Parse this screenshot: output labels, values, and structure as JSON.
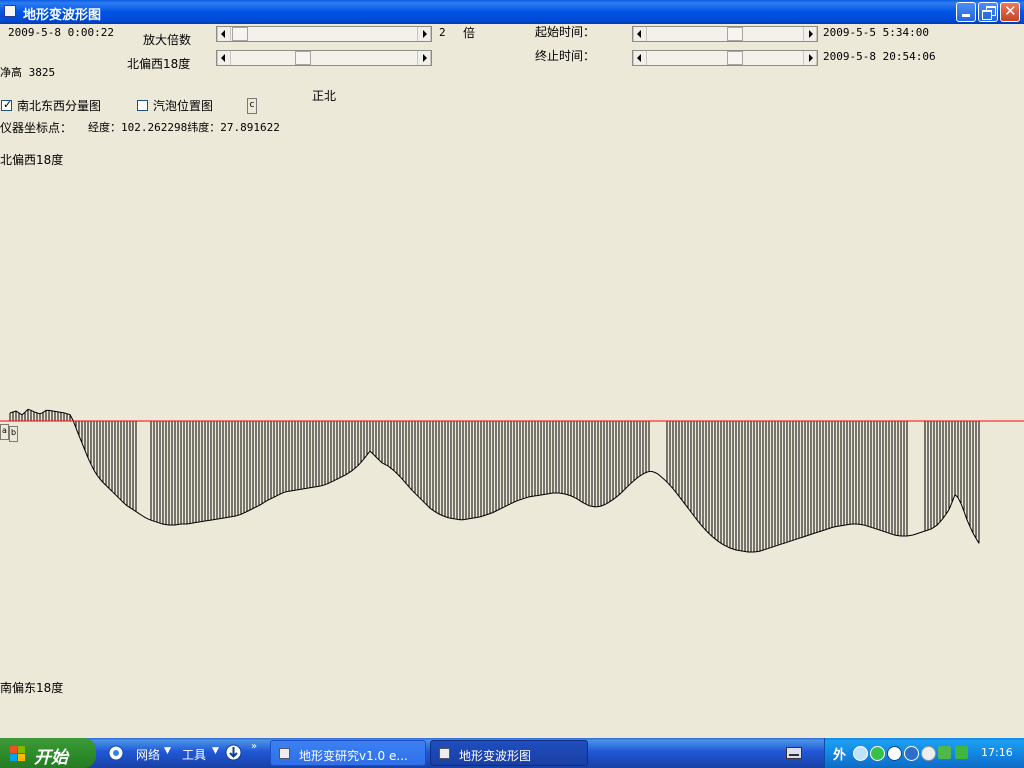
{
  "window": {
    "title": "地形变波形图"
  },
  "top": {
    "current_datetime": "2009-5-8 0:00:22",
    "magnify_label": "放大倍数",
    "magnify_value": "2",
    "magnify_unit": "倍",
    "angle_label": "北偏西18度",
    "net_height": "净高 3825",
    "start_time_label": "起始时间：",
    "start_time_value": "2009-5-5 5:34:00",
    "end_time_label": "终止时间：",
    "end_time_value": "2009-5-8 20:54:06"
  },
  "options": {
    "ns_ew_label": "南北东西分量图",
    "ns_ew_checked": true,
    "bubble_label": "汽泡位置图",
    "bubble_checked": false,
    "c_button": "c",
    "north_label": "正北"
  },
  "coords": {
    "label": "仪器坐标点：",
    "value": "经度：102.262298纬度：27.891622"
  },
  "plot": {
    "top_label": "北偏西18度",
    "bottom_label": "南偏东18度",
    "a_label": "a",
    "b_label": "b",
    "baseline_color": "#ff0000",
    "series": [
      8,
      10,
      6,
      12,
      9,
      7,
      11,
      10,
      9,
      8,
      6,
      -10,
      -25,
      -40,
      -52,
      -60,
      -66,
      -72,
      -78,
      -84,
      -88,
      -92,
      -96,
      -99,
      -101,
      -103,
      -104,
      -104,
      -103,
      -103,
      -102,
      -101,
      -100,
      -99,
      -98,
      -97,
      -96,
      -95,
      -93,
      -90,
      -87,
      -84,
      -80,
      -77,
      -74,
      -71,
      -70,
      -69,
      -68,
      -67,
      -66,
      -65,
      -63,
      -60,
      -57,
      -54,
      -50,
      -45,
      -38,
      -30,
      -36,
      -42,
      -45,
      -50,
      -56,
      -63,
      -70,
      -76,
      -82,
      -88,
      -92,
      -95,
      -97,
      -98,
      -99,
      -98,
      -97,
      -96,
      -94,
      -92,
      -89,
      -86,
      -83,
      -80,
      -78,
      -76,
      -75,
      -74,
      -73,
      -72,
      -72,
      -73,
      -75,
      -78,
      -82,
      -85,
      -86,
      -85,
      -82,
      -78,
      -73,
      -67,
      -61,
      -56,
      -52,
      -50,
      -52,
      -57,
      -63,
      -70,
      -78,
      -86,
      -94,
      -102,
      -109,
      -115,
      -120,
      -124,
      -127,
      -129,
      -130,
      -131,
      -131,
      -130,
      -128,
      -126,
      -124,
      -122,
      -120,
      -118,
      -116,
      -114,
      -112,
      -110,
      -108,
      -106,
      -105,
      -104,
      -103,
      -103,
      -104,
      -106,
      -108,
      -110,
      -112,
      -114,
      -115,
      -115,
      -114,
      -112,
      -110,
      -108,
      -104,
      -97,
      -88,
      -72,
      -84,
      -101,
      -114,
      -124
    ]
  }
}
